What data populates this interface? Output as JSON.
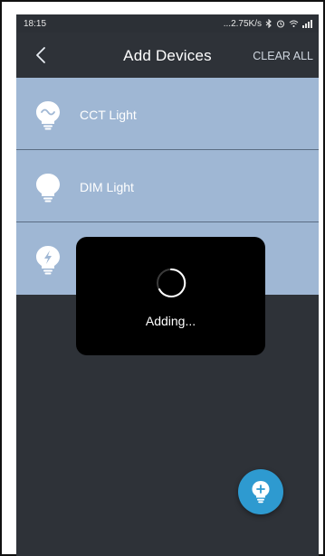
{
  "status_bar": {
    "time": "18:15",
    "network_speed": "...2.75K/s",
    "icons": [
      "bluetooth-icon",
      "alarm-icon",
      "wifi-icon",
      "signal-icon"
    ]
  },
  "header": {
    "title": "Add Devices",
    "clear_all_label": "CLEAR ALL",
    "back_icon": "chevron-left-icon"
  },
  "devices": [
    {
      "label": "CCT Light",
      "icon": "cct-bulb-icon"
    },
    {
      "label": "DIM Light",
      "icon": "dim-bulb-icon"
    },
    {
      "label": "",
      "icon": "rgb-bulb-icon"
    }
  ],
  "loading_dialog": {
    "text": "Adding..."
  },
  "fab": {
    "icon": "add-bulb-icon"
  },
  "colors": {
    "background": "#2e3238",
    "list_background": "#9fb7d4",
    "dialog_background": "#000000",
    "fab_color": "#2e9ad0"
  }
}
